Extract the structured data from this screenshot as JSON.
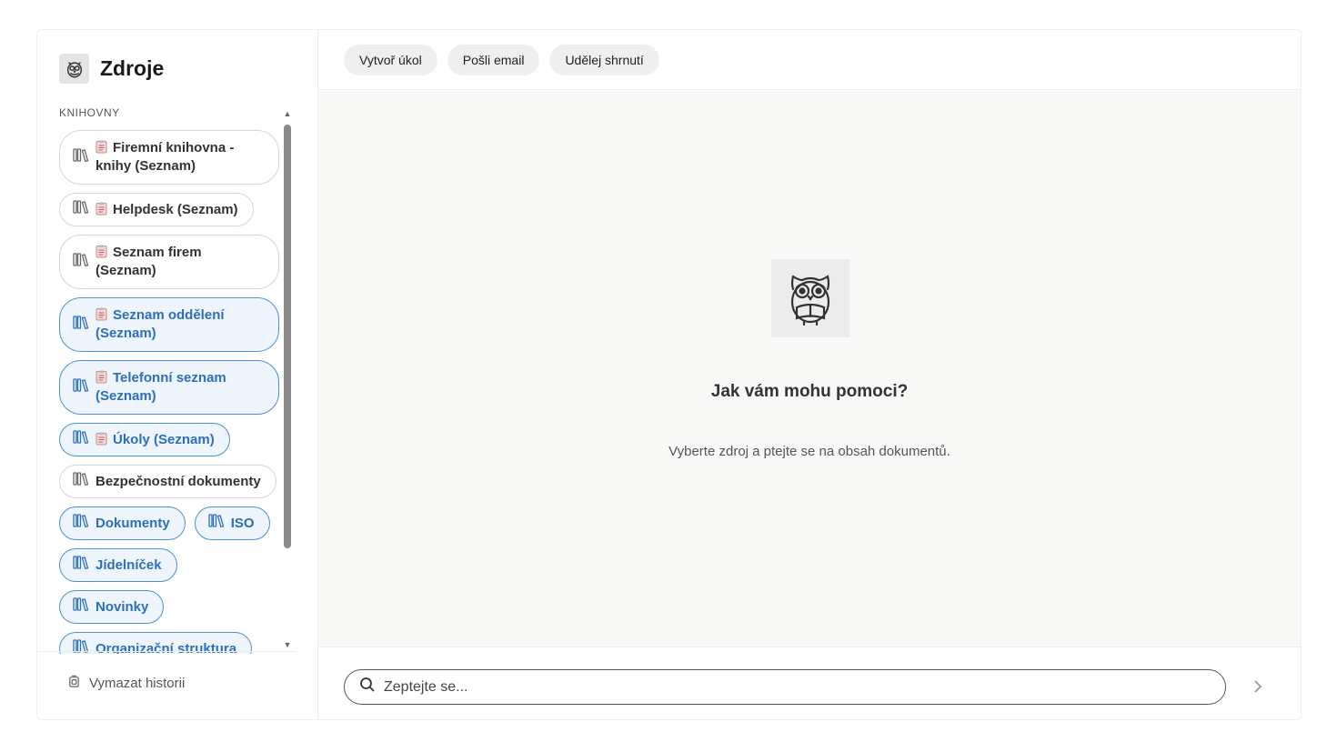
{
  "sidebar": {
    "title": "Zdroje",
    "section_label": "KNIHOVNY",
    "libraries": [
      {
        "label": "Firemní knihovna - knihy (Seznam)",
        "doc": true,
        "selected": false,
        "big": true
      },
      {
        "label": "Helpdesk (Seznam)",
        "doc": true,
        "selected": false,
        "big": false
      },
      {
        "label": "Seznam firem (Seznam)",
        "doc": true,
        "selected": false,
        "big": true
      },
      {
        "label": "Seznam oddělení (Seznam)",
        "doc": true,
        "selected": true,
        "big": true
      },
      {
        "label": "Telefonní seznam (Seznam)",
        "doc": true,
        "selected": true,
        "big": true
      },
      {
        "label": "Úkoly (Seznam)",
        "doc": true,
        "selected": true,
        "big": false
      },
      {
        "label": "Bezpečnostní dokumenty",
        "doc": false,
        "selected": false,
        "big": false
      },
      {
        "label": "Dokumenty",
        "doc": false,
        "selected": true,
        "big": false
      },
      {
        "label": "ISO",
        "doc": false,
        "selected": true,
        "big": false
      },
      {
        "label": "Jídelníček",
        "doc": false,
        "selected": true,
        "big": false
      },
      {
        "label": "Novinky",
        "doc": false,
        "selected": true,
        "big": false
      },
      {
        "label": "Organizační struktura",
        "doc": false,
        "selected": true,
        "big": false
      }
    ],
    "clear_history_label": "Vymazat historii"
  },
  "toolbar": {
    "actions": [
      "Vytvoř úkol",
      "Pošli email",
      "Udělej shrnutí"
    ]
  },
  "chat": {
    "welcome_title": "Jak vám mohu pomoci?",
    "welcome_subtitle": "Vyberte zdroj a ptejte se na obsah dokumentů."
  },
  "input": {
    "placeholder": "Zeptejte se..."
  },
  "colors": {
    "selected_border": "#4f8fd6",
    "selected_bg": "#eef5fd",
    "selected_text": "#2d6fba"
  }
}
